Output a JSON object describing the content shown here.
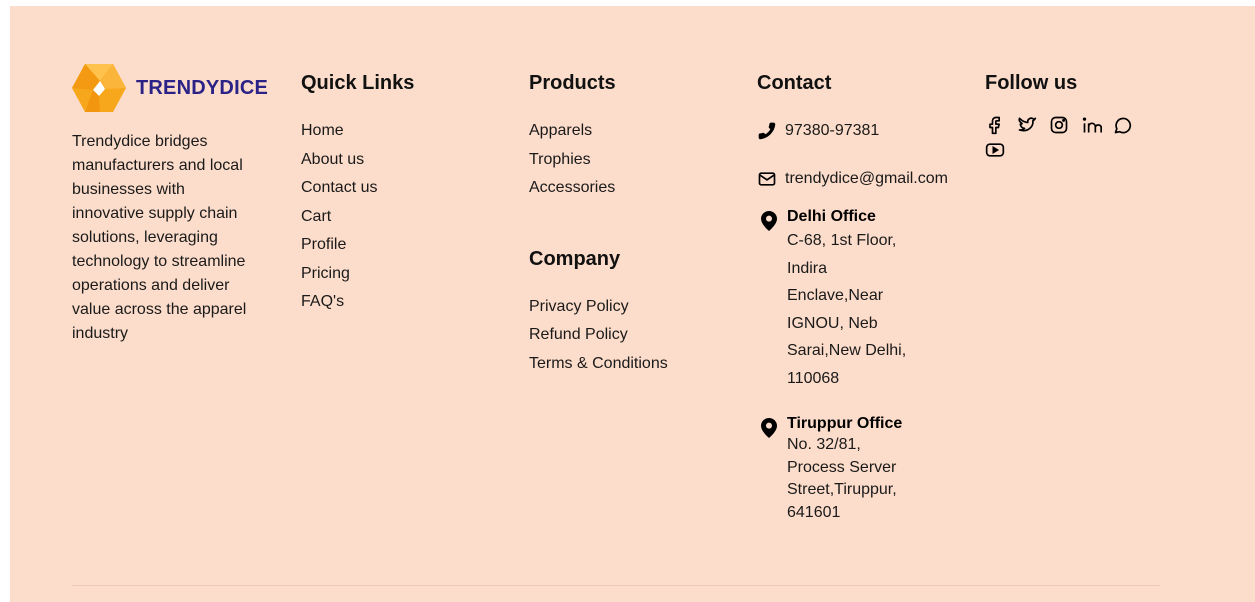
{
  "brand": {
    "name": "TRENDYDICE",
    "description": "Trendydice bridges manufacturers and local businesses with innovative supply chain solutions, leveraging technology to streamline operations and deliver value across the apparel industry"
  },
  "quick_links": {
    "title": "Quick Links",
    "items": [
      "Home",
      "About us",
      "Contact us",
      "Cart",
      "Profile",
      "Pricing",
      "FAQ's"
    ]
  },
  "products": {
    "title": "Products",
    "items": [
      "Apparels",
      "Trophies",
      "Accessories"
    ]
  },
  "company": {
    "title": "Company",
    "items": [
      "Privacy Policy",
      "Refund Policy",
      "Terms & Conditions"
    ]
  },
  "contact": {
    "title": "Contact",
    "phone": "97380-97381",
    "email": "trendydice@gmail.com",
    "offices": [
      {
        "title": "Delhi Office",
        "address": "C-68, 1st Floor, Indira Enclave,Near IGNOU, Neb Sarai,New Delhi, 110068"
      },
      {
        "title": "Tiruppur Office",
        "address": "No. 32/81, Process Server Street,Tiruppur, 641601"
      }
    ]
  },
  "follow": {
    "title": "Follow us",
    "icons": [
      "facebook-icon",
      "twitter-icon",
      "instagram-icon",
      "linkedin-icon",
      "whatsapp-icon",
      "youtube-icon"
    ]
  },
  "colors": {
    "background": "#fcdcca",
    "brand_text": "#2a2287",
    "logo_orange": "#f7a71c"
  }
}
